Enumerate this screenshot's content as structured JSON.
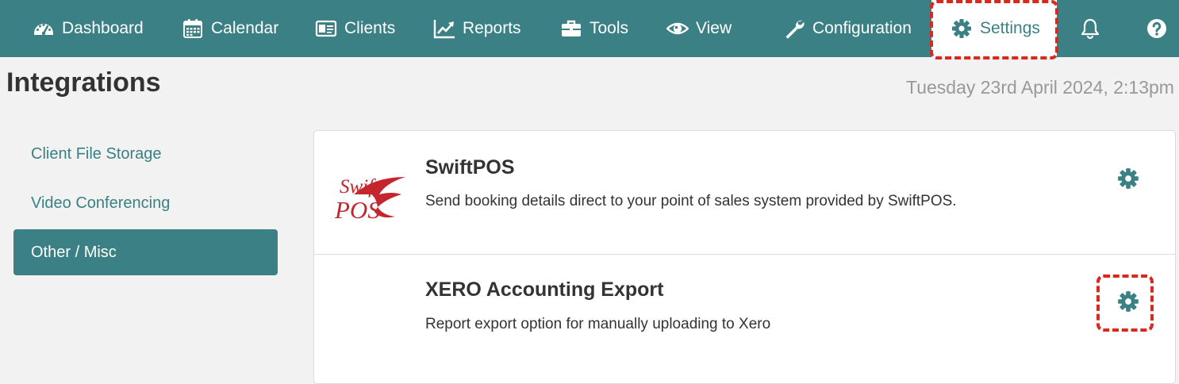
{
  "nav": {
    "items": [
      {
        "id": "dashboard",
        "label": "Dashboard",
        "icon": "dashboard-gauge-icon"
      },
      {
        "id": "calendar",
        "label": "Calendar",
        "icon": "calendar-icon"
      },
      {
        "id": "clients",
        "label": "Clients",
        "icon": "id-card-icon"
      },
      {
        "id": "reports",
        "label": "Reports",
        "icon": "line-chart-icon"
      },
      {
        "id": "tools",
        "label": "Tools",
        "icon": "toolbox-icon"
      },
      {
        "id": "view",
        "label": "View",
        "icon": "eye-icon"
      },
      {
        "id": "configuration",
        "label": "Configuration",
        "icon": "wrench-icon"
      },
      {
        "id": "settings",
        "label": "Settings",
        "icon": "gear-icon",
        "active": true
      }
    ],
    "notifications_icon": "bell-icon",
    "help_icon": "question-circle-icon"
  },
  "page": {
    "title": "Integrations",
    "datetime": "Tuesday 23rd April 2024, 2:13pm"
  },
  "sidebar": {
    "items": [
      {
        "label": "Client File Storage"
      },
      {
        "label": "Video Conferencing"
      },
      {
        "label": "Other / Misc",
        "active": true
      }
    ]
  },
  "integrations": [
    {
      "name": "SwiftPOS",
      "description": "Send booking details direct to your point of sales system provided by SwiftPOS.",
      "logo_text_top": "Swift",
      "logo_text_bottom": "POS",
      "settings_icon": "gear-icon"
    },
    {
      "name": "XERO Accounting Export",
      "description": "Report export option for manually uploading to Xero",
      "settings_icon": "gear-icon"
    }
  ],
  "colors": {
    "primary": "#3a8084",
    "background": "#f2f2f2",
    "highlight": "#d9291f",
    "logo_red": "#c4262e"
  }
}
